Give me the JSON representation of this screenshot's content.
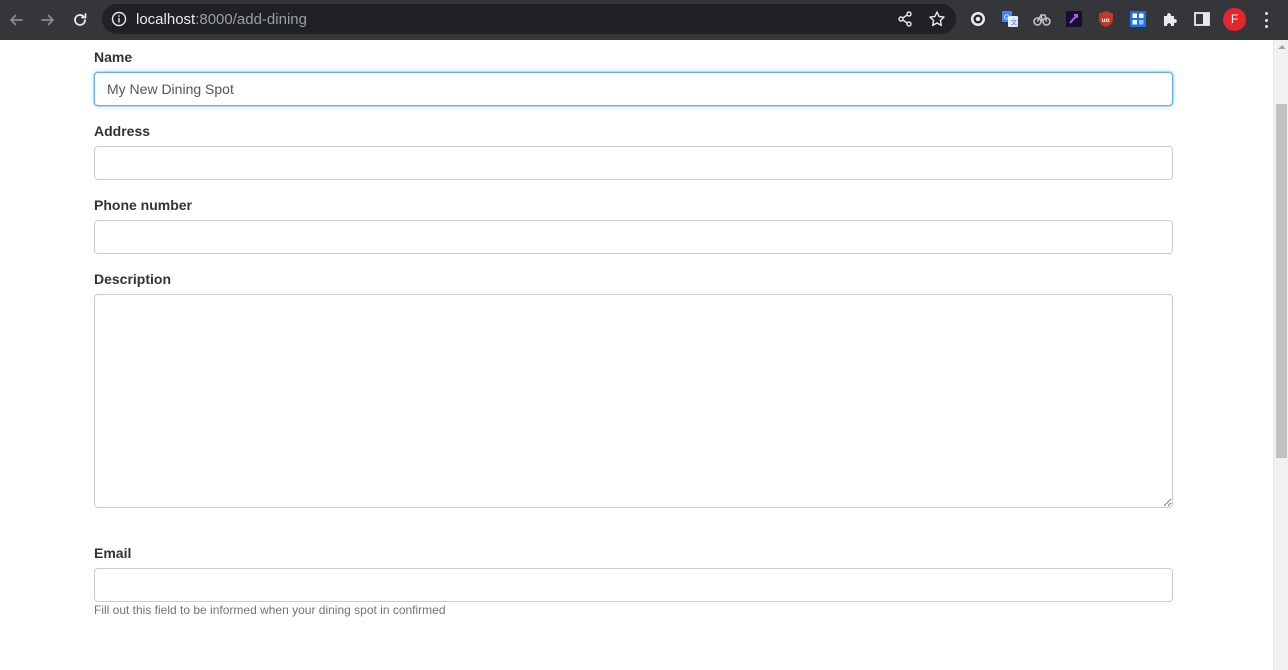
{
  "browser": {
    "url_host": "localhost",
    "url_path": ":8000/add-dining",
    "profile_initial": "F",
    "extensions": [
      {
        "name": "extension-circle-icon",
        "color": "#e8eaed"
      },
      {
        "name": "google-translate-icon",
        "color": "#4285f4"
      },
      {
        "name": "extension-bike-icon",
        "color": "#bdc1c6"
      },
      {
        "name": "extension-purple-icon",
        "color": "#7b2cbf"
      },
      {
        "name": "ublock-origin-icon",
        "color": "#c0392b"
      },
      {
        "name": "extension-blue-grid-icon",
        "color": "#1a73e8"
      }
    ]
  },
  "form": {
    "name_label": "Name",
    "name_value": "My New Dining Spot",
    "address_label": "Address",
    "address_value": "",
    "phone_label": "Phone number",
    "phone_value": "",
    "description_label": "Description",
    "description_value": "",
    "email_label": "Email",
    "email_value": "",
    "email_help": "Fill out this field to be informed when your dining spot in confirmed"
  },
  "colors": {
    "toolbar": "#35363a",
    "omnibox": "#202124",
    "focus_border": "#66afe9",
    "label_text": "#333333",
    "avatar": "#e6262e"
  }
}
